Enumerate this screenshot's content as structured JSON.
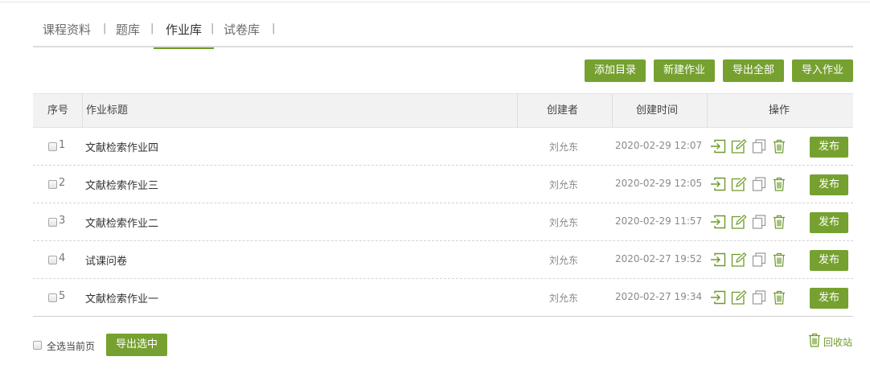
{
  "tabs": [
    {
      "label": "课程资料"
    },
    {
      "label": "题库"
    },
    {
      "label": "作业库"
    },
    {
      "label": "试卷库"
    }
  ],
  "tab_separator": "|",
  "active_tab": "作业库",
  "toolbar": {
    "add_catalog": "添加目录",
    "new_homework": "新建作业",
    "export_all": "导出全部",
    "import_homework": "导入作业"
  },
  "table": {
    "headers": {
      "index": "序号",
      "title": "作业标题",
      "creator": "创建者",
      "created_time": "创建时间",
      "actions": "操作"
    },
    "rows": [
      {
        "index": "1",
        "title": "文献检索作业四",
        "creator": "刘允东",
        "time": "2020-02-29 12:07",
        "publish": "发布"
      },
      {
        "index": "2",
        "title": "文献检索作业三",
        "creator": "刘允东",
        "time": "2020-02-29 12:05",
        "publish": "发布"
      },
      {
        "index": "3",
        "title": "文献检索作业二",
        "creator": "刘允东",
        "time": "2020-02-29 11:57",
        "publish": "发布"
      },
      {
        "index": "4",
        "title": "试课问卷",
        "creator": "刘允东",
        "time": "2020-02-27 19:52",
        "publish": "发布"
      },
      {
        "index": "5",
        "title": "文献检索作业一",
        "creator": "刘允东",
        "time": "2020-02-27 19:34",
        "publish": "发布"
      }
    ],
    "row_action_icons": [
      "move-icon",
      "edit-icon",
      "copy-icon",
      "trash-icon"
    ]
  },
  "footer": {
    "select_all_label": "全选当前页",
    "export_selected": "导出选中",
    "recycle_bin": "回收站"
  },
  "colors": {
    "accent": "#76a130",
    "icon": "#6e9a2a"
  }
}
